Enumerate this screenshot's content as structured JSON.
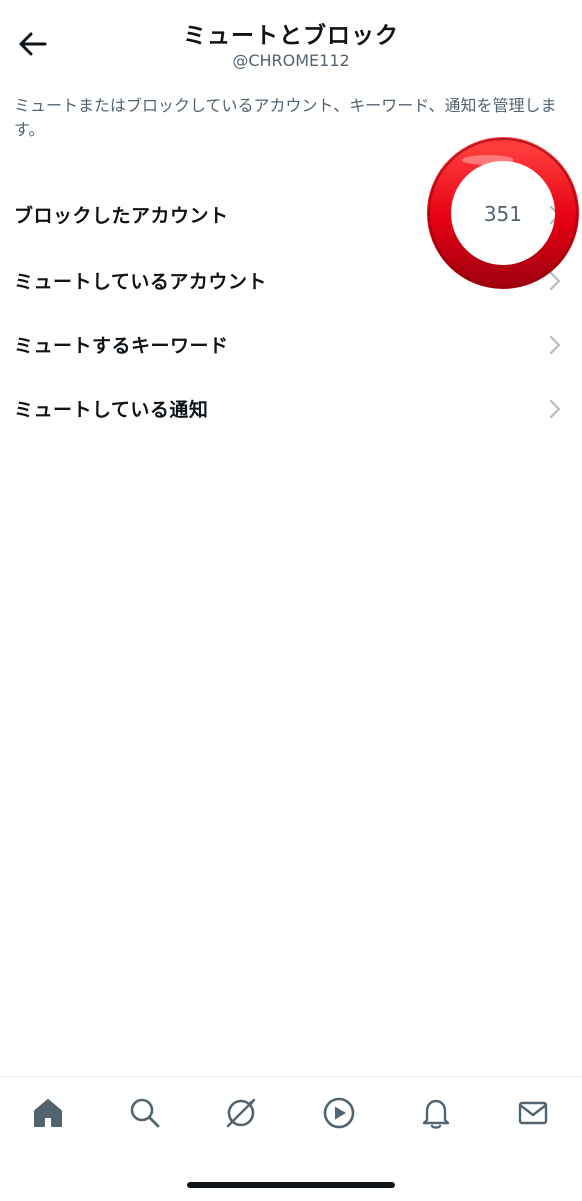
{
  "header": {
    "title": "ミュートとブロック",
    "subtitle": "@CHROME112"
  },
  "description": "ミュートまたはブロックしているアカウント、キーワード、通知を管理します。",
  "items": [
    {
      "label": "ブロックしたアカウント",
      "count": "351"
    },
    {
      "label": "ミュートしているアカウント",
      "count": ""
    },
    {
      "label": "ミュートするキーワード",
      "count": ""
    },
    {
      "label": "ミュートしている通知",
      "count": ""
    }
  ],
  "tabbar": {
    "icons": [
      "home-icon",
      "search-icon",
      "spaces-icon",
      "video-play-icon",
      "bell-icon",
      "mail-icon"
    ]
  },
  "colors": {
    "text_primary": "#0f1419",
    "text_secondary": "#536471",
    "chevron": "#b0bbc3",
    "annotation_red": "#e60012"
  }
}
